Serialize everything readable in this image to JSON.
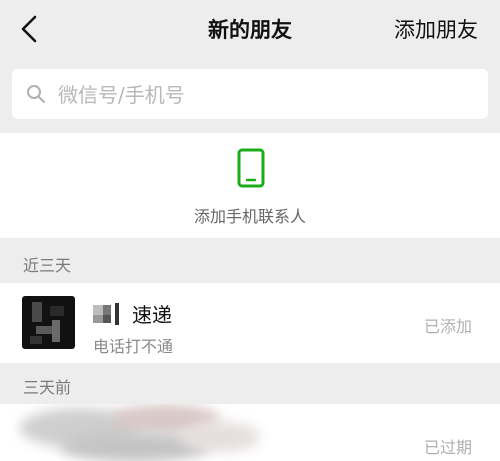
{
  "nav": {
    "title": "新的朋友",
    "add_label": "添加朋友"
  },
  "search": {
    "placeholder": "微信号/手机号",
    "value": ""
  },
  "phone_contacts": {
    "label": "添加手机联系人",
    "icon": "phone-icon",
    "accent": "#1aad19"
  },
  "sections": {
    "recent": "近三天",
    "older": "三天前"
  },
  "requests": [
    {
      "name": "速递",
      "subtitle": "电话打不通",
      "status": "已添加",
      "avatar": "pixelated-avatar"
    },
    {
      "name": "",
      "subtitle": "",
      "status": "已过期",
      "avatar": "blurred-avatar"
    }
  ]
}
